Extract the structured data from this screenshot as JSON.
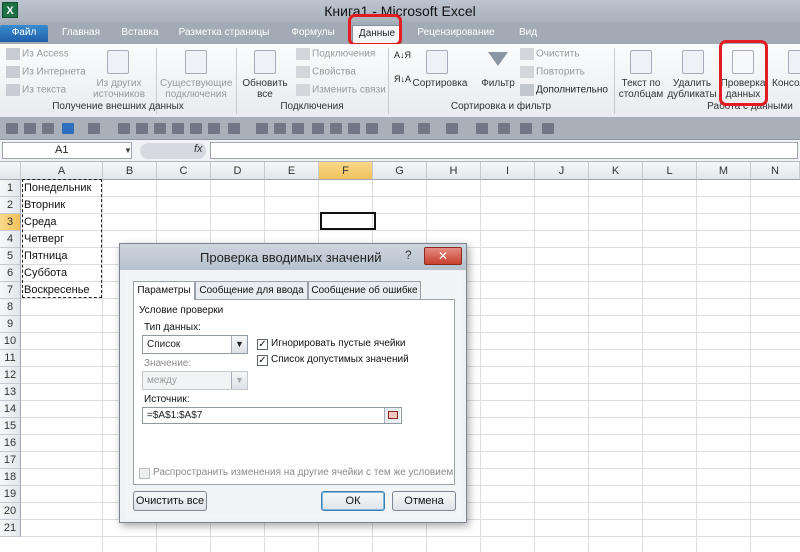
{
  "window": {
    "title": "Книга1 - Microsoft Excel",
    "app_icon": "excel-icon"
  },
  "tabs": [
    {
      "label": "Файл"
    },
    {
      "label": "Главная"
    },
    {
      "label": "Вставка"
    },
    {
      "label": "Разметка страницы"
    },
    {
      "label": "Формулы"
    },
    {
      "label": "Данные",
      "selected": true
    },
    {
      "label": "Рецензирование"
    },
    {
      "label": "Вид"
    }
  ],
  "ribbon": {
    "get_external": {
      "from_access": "Из Access",
      "from_web": "Из Интернета",
      "from_text": "Из текста",
      "from_other_1": "Из других",
      "from_other_2": "источников",
      "existing_1": "Существующие",
      "existing_2": "подключения",
      "group_label": "Получение внешних данных"
    },
    "connections": {
      "refresh_1": "Обновить",
      "refresh_2": "все",
      "connections": "Подключения",
      "properties": "Свойства",
      "edit_links": "Изменить связи",
      "group_label": "Подключения"
    },
    "sort_filter": {
      "sort": "Сортировка",
      "filter": "Фильтр",
      "clear": "Очистить",
      "reapply": "Повторить",
      "advanced": "Дополнительно",
      "group_label": "Сортировка и фильтр"
    },
    "data_tools": {
      "text_to_cols_1": "Текст по",
      "text_to_cols_2": "столбцам",
      "remove_dup_1": "Удалить",
      "remove_dup_2": "дубликаты",
      "validation_1": "Проверка",
      "validation_2": "данных",
      "consolidate": "Консол",
      "group_label": "Работа с данными"
    },
    "highlight_color": "#e31b23"
  },
  "formula_bar": {
    "name_box": "A1",
    "fx": "fx",
    "formula": ""
  },
  "grid": {
    "columns": [
      "A",
      "B",
      "C",
      "D",
      "E",
      "F",
      "G",
      "H",
      "I",
      "J",
      "K",
      "L",
      "M",
      "N"
    ],
    "rows": [
      "1",
      "2",
      "3",
      "4",
      "5",
      "6",
      "7",
      "8",
      "9",
      "10",
      "11",
      "12",
      "13",
      "14",
      "15",
      "16",
      "17",
      "18",
      "19",
      "20",
      "21"
    ],
    "column_a_values": [
      "Понедельник",
      "Вторник",
      "Среда",
      "Четверг",
      "Пятница",
      "Суббота",
      "Воскресенье"
    ]
  },
  "dialog": {
    "title": "Проверка вводимых значений",
    "help": "?",
    "close": "✕",
    "tabs": [
      "Параметры",
      "Сообщение для ввода",
      "Сообщение об ошибке"
    ],
    "section": "Условие проверки",
    "data_type_label": "Тип данных:",
    "data_type_value": "Список",
    "value_label": "Значение:",
    "value_value": "между",
    "ignore_blank": {
      "label": "Игнорировать пустые ячейки",
      "checked": true
    },
    "dropdown_list": {
      "label": "Список допустимых значений",
      "checked": true
    },
    "source_label": "Источник:",
    "source_value": "=$A$1:$A$7",
    "apply_all": {
      "label": "Распространить изменения на другие ячейки с тем же условием",
      "checked": false
    },
    "clear_all": "Очистить все",
    "ok": "ОК",
    "cancel": "Отмена"
  }
}
